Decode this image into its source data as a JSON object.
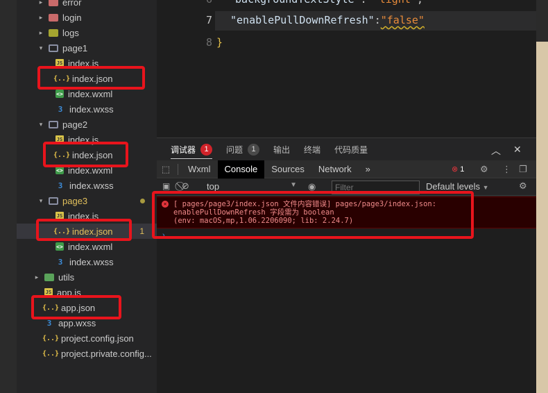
{
  "explorer": {
    "items": [
      {
        "label": "error",
        "type": "folder-red",
        "indent": 1,
        "chevron": "▸"
      },
      {
        "label": "login",
        "type": "folder-red",
        "indent": 1,
        "chevron": "▸"
      },
      {
        "label": "logs",
        "type": "folder-logs",
        "indent": 1,
        "chevron": "▸"
      },
      {
        "label": "page1",
        "type": "folder-open",
        "indent": 1,
        "chevron": "▾"
      },
      {
        "label": "index.js",
        "type": "js",
        "indent": 2
      },
      {
        "label": "index.json",
        "type": "json",
        "indent": 2
      },
      {
        "label": "index.wxml",
        "type": "wxml",
        "indent": 2
      },
      {
        "label": "index.wxss",
        "type": "wxss",
        "indent": 2
      },
      {
        "label": "page2",
        "type": "folder-open",
        "indent": 1,
        "chevron": "▾"
      },
      {
        "label": "index.js",
        "type": "js",
        "indent": 2
      },
      {
        "label": "index.json",
        "type": "json",
        "indent": 2
      },
      {
        "label": "index.wxml",
        "type": "wxml",
        "indent": 2
      },
      {
        "label": "index.wxss",
        "type": "wxss",
        "indent": 2
      },
      {
        "label": "page3",
        "type": "folder-open",
        "indent": 1,
        "chevron": "▾",
        "modified": true
      },
      {
        "label": "index.js",
        "type": "js",
        "indent": 2
      },
      {
        "label": "index.json",
        "type": "json",
        "indent": 2,
        "active": true,
        "problems": "1"
      },
      {
        "label": "index.wxml",
        "type": "wxml",
        "indent": 2
      },
      {
        "label": "index.wxss",
        "type": "wxss",
        "indent": 2
      },
      {
        "label": "utils",
        "type": "folder-green",
        "indent": 0,
        "chevron": "▸"
      },
      {
        "label": "app.js",
        "type": "js",
        "indent": 0
      },
      {
        "label": "app.json",
        "type": "json",
        "indent": 0
      },
      {
        "label": "app.wxss",
        "type": "wxss",
        "indent": 0
      },
      {
        "label": "project.config.json",
        "type": "json",
        "indent": 0
      },
      {
        "label": "project.private.config...",
        "type": "json",
        "indent": 0
      }
    ]
  },
  "editor": {
    "lines": [
      {
        "num": "6",
        "key": "\"backgroundTextStyle\"",
        "sep": ":",
        "value": "\"light\"",
        "trail": ","
      },
      {
        "num": "7",
        "key": "\"enablePullDownRefresh\"",
        "sep": ":",
        "value": "\"false\"",
        "trail": ""
      },
      {
        "num": "8",
        "key": "}",
        "sep": "",
        "value": "",
        "trail": ""
      }
    ]
  },
  "panel": {
    "tabs": [
      {
        "label": "调试器",
        "count": "1"
      },
      {
        "label": "问题",
        "count": "1"
      },
      {
        "label": "输出"
      },
      {
        "label": "终端"
      },
      {
        "label": "代码质量"
      }
    ],
    "devtools_tabs": [
      "Wxml",
      "Console",
      "Sources",
      "Network"
    ],
    "more": "»",
    "error_count": "1",
    "context": "top",
    "filter_placeholder": "Filter",
    "levels": "Default levels",
    "error_lines": [
      "[ pages/page3/index.json 文件内容错误] pages/page3/index.json:",
      "enablePullDownRefresh 字段需为 boolean",
      "(env: macOS,mp,1.06.2206090; lib: 2.24.7)"
    ],
    "prompt": "›"
  },
  "colors": {
    "highlight_box": "#e8141c",
    "error_bg": "#290000",
    "accent_yellow": "#e2c05c"
  }
}
